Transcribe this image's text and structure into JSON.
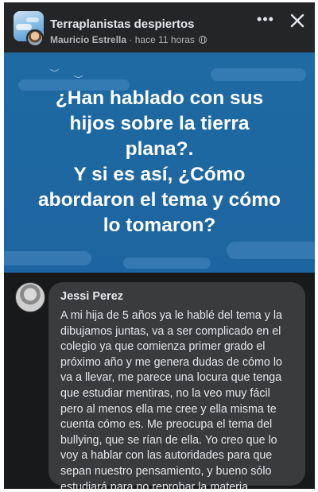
{
  "post": {
    "group_name": "Terraplanistas despiertos",
    "author": "Mauricio Estrella",
    "separator": "·",
    "time": "hace 11 horas",
    "more_icon": "more-options-icon",
    "close_icon": "close-icon",
    "privacy_icon": "globe-icon",
    "text_lines": [
      "¿Han hablado con sus",
      "hijos sobre la tierra",
      "plana?.",
      "Y si es así, ¿Cómo",
      "abordaron el tema y cómo",
      "lo tomaron?"
    ],
    "background_color": "#1f6aa3"
  },
  "comment": {
    "name": "Jessi Perez",
    "lines": [
      "A mi hija de 5 años ya le hablé del tema y la",
      "dibujamos juntas, va a ser complicado en el",
      "colegio ya que comienza primer grado el",
      "próximo año y me genera dudas de cómo lo",
      "va a llevar, me parece una locura que tenga",
      "que estudiar mentiras, no la veo muy fácil",
      "pero al menos ella me cree y ella misma te",
      "cuenta cómo es. Me preocupa el tema del",
      "bullying, que se rían de ella. Yo creo que lo",
      "voy a hablar con las autoridades para que",
      "sepan nuestro pensamiento, y bueno sólo",
      "estudiará para no reprobar la materia."
    ]
  }
}
